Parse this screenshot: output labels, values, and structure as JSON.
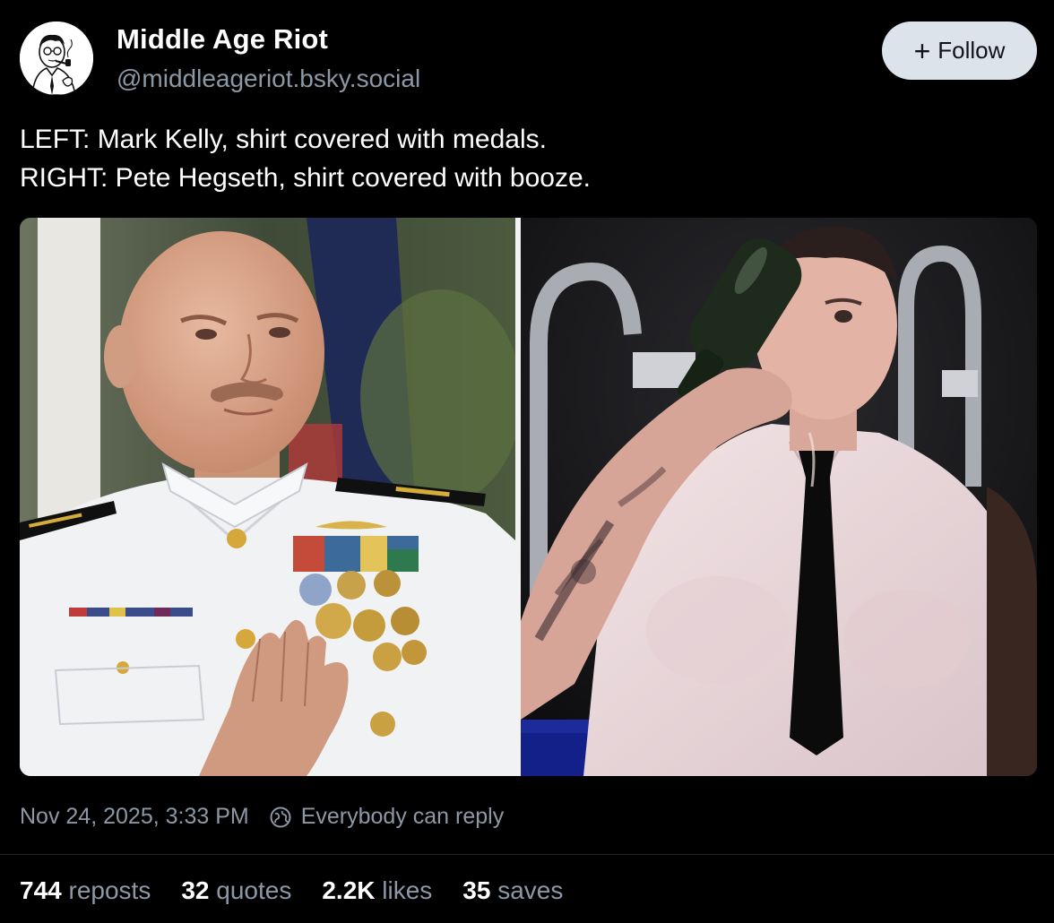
{
  "author": {
    "display_name": "Middle Age Riot",
    "handle": "@middleageriot.bsky.social",
    "avatar_icon": "man-with-pipe-avatar"
  },
  "follow_button": {
    "icon": "plus-icon",
    "label": "Follow"
  },
  "post": {
    "lines": [
      "LEFT: Mark Kelly, shirt covered with medals.",
      "RIGHT: Pete Hegseth, shirt covered with booze."
    ]
  },
  "media": {
    "images": [
      {
        "name": "photo-mark-kelly"
      },
      {
        "name": "photo-pete-hegseth"
      }
    ]
  },
  "meta": {
    "timestamp": "Nov 24, 2025, 3:33 PM",
    "reply_icon": "globe-reply-icon",
    "reply_setting": "Everybody can reply"
  },
  "stats": {
    "reposts": {
      "count": "744",
      "label": "reposts"
    },
    "quotes": {
      "count": "32",
      "label": "quotes"
    },
    "likes": {
      "count": "2.2K",
      "label": "likes"
    },
    "saves": {
      "count": "35",
      "label": "saves"
    }
  },
  "colors": {
    "background": "#000000",
    "text": "#ffffff",
    "muted": "#8d98a6",
    "follow_bg": "#dde3ea",
    "follow_text": "#101418"
  }
}
